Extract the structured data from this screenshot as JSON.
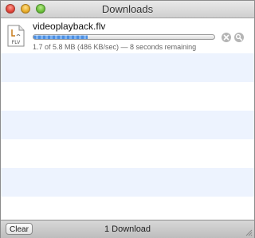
{
  "window": {
    "title": "Downloads"
  },
  "download": {
    "filename": "videoplayback.flv",
    "file_type": "FLV",
    "progress_percent": 30,
    "status": "1.7 of 5.8 MB (486 KB/sec) — 8 seconds remaining"
  },
  "footer": {
    "clear_label": "Clear",
    "count_label": "1 Download"
  },
  "colors": {
    "stripe": "#edf3fe",
    "progress": "#4d8fe0"
  }
}
